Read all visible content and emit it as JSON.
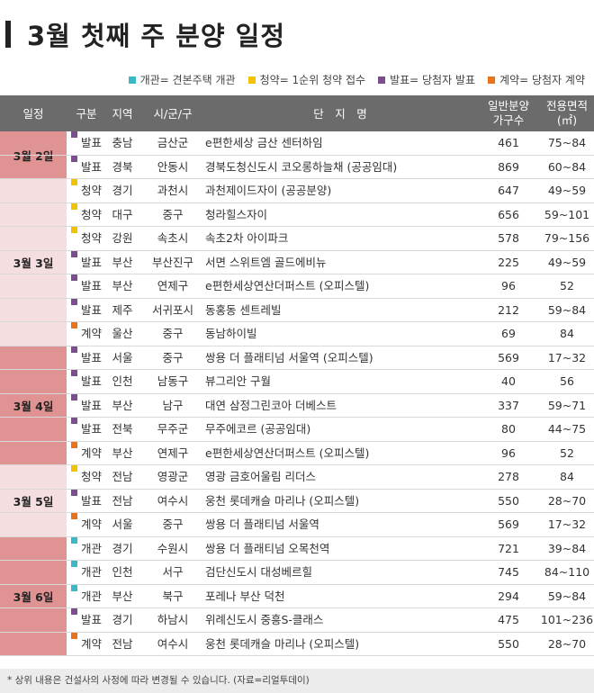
{
  "title": "3월 첫째 주 분양 일정",
  "legend": [
    {
      "label": "개관= 견본주택 개관",
      "color": "#3ab8c4"
    },
    {
      "label": "청약= 1순위 청약 접수",
      "color": "#f2c200"
    },
    {
      "label": "발표= 당첨자 발표",
      "color": "#7b4f8f"
    },
    {
      "label": "계약= 당첨자 계약",
      "color": "#e8731a"
    }
  ],
  "headers": {
    "date": "일정",
    "type": "구분",
    "region": "지역",
    "city": "시/군/구",
    "name": "단　지　명",
    "units_1": "일반분양",
    "units_2": "가구수",
    "area_1": "전용면적",
    "area_2": "(㎡)"
  },
  "groups": [
    {
      "date": "3월 2일",
      "bg": "#e09393",
      "rows": [
        {
          "type": "발표",
          "color": "#7b4f8f",
          "region": "충남",
          "city": "금산군",
          "name": "e편한세상 금산 센터하임",
          "units": "461",
          "area": "75~84"
        },
        {
          "type": "발표",
          "color": "#7b4f8f",
          "region": "경북",
          "city": "안동시",
          "name": "경북도청신도시 코오롱하늘채 (공공임대)",
          "units": "869",
          "area": "60~84"
        }
      ]
    },
    {
      "date": "3월 3일",
      "bg": "#f5dedf",
      "rows": [
        {
          "type": "청약",
          "color": "#f2c200",
          "region": "경기",
          "city": "과천시",
          "name": "과천제이드자이 (공공분양)",
          "units": "647",
          "area": "49~59"
        },
        {
          "type": "청약",
          "color": "#f2c200",
          "region": "대구",
          "city": "중구",
          "name": "청라힐스자이",
          "units": "656",
          "area": "59~101"
        },
        {
          "type": "청약",
          "color": "#f2c200",
          "region": "강원",
          "city": "속초시",
          "name": "속초2차 아이파크",
          "units": "578",
          "area": "79~156"
        },
        {
          "type": "발표",
          "color": "#7b4f8f",
          "region": "부산",
          "city": "부산진구",
          "name": "서면 스위트엠 골드에비뉴",
          "units": "225",
          "area": "49~59"
        },
        {
          "type": "발표",
          "color": "#7b4f8f",
          "region": "부산",
          "city": "연제구",
          "name": "e편한세상연산더퍼스트 (오피스텔)",
          "units": "96",
          "area": "52"
        },
        {
          "type": "발표",
          "color": "#7b4f8f",
          "region": "제주",
          "city": "서귀포시",
          "name": "동홍동 센트레빌",
          "units": "212",
          "area": "59~84"
        },
        {
          "type": "계약",
          "color": "#e8731a",
          "region": "울산",
          "city": "중구",
          "name": "동남하이빌",
          "units": "69",
          "area": "84"
        }
      ]
    },
    {
      "date": "3월 4일",
      "bg": "#e09393",
      "rows": [
        {
          "type": "발표",
          "color": "#7b4f8f",
          "region": "서울",
          "city": "중구",
          "name": "쌍용 더 플래티넘 서울역 (오피스텔)",
          "units": "569",
          "area": "17~32"
        },
        {
          "type": "발표",
          "color": "#7b4f8f",
          "region": "인천",
          "city": "남동구",
          "name": "뷰그리안 구월",
          "units": "40",
          "area": "56"
        },
        {
          "type": "발표",
          "color": "#7b4f8f",
          "region": "부산",
          "city": "남구",
          "name": "대연 삼정그린코아 더베스트",
          "units": "337",
          "area": "59~71"
        },
        {
          "type": "발표",
          "color": "#7b4f8f",
          "region": "전북",
          "city": "무주군",
          "name": "무주에코르 (공공임대)",
          "units": "80",
          "area": "44~75"
        },
        {
          "type": "계약",
          "color": "#e8731a",
          "region": "부산",
          "city": "연제구",
          "name": "e편한세상연산더퍼스트 (오피스텔)",
          "units": "96",
          "area": "52"
        }
      ]
    },
    {
      "date": "3월 5일",
      "bg": "#f5dedf",
      "rows": [
        {
          "type": "청약",
          "color": "#f2c200",
          "region": "전남",
          "city": "영광군",
          "name": "영광 금호어울림 리더스",
          "units": "278",
          "area": "84"
        },
        {
          "type": "발표",
          "color": "#7b4f8f",
          "region": "전남",
          "city": "여수시",
          "name": "웅천 롯데캐슬 마리나 (오피스텔)",
          "units": "550",
          "area": "28~70"
        },
        {
          "type": "계약",
          "color": "#e8731a",
          "region": "서울",
          "city": "중구",
          "name": "쌍용 더 플래티넘 서울역",
          "units": "569",
          "area": "17~32"
        }
      ]
    },
    {
      "date": "3월 6일",
      "bg": "#e09393",
      "rows": [
        {
          "type": "개관",
          "color": "#3ab8c4",
          "region": "경기",
          "city": "수원시",
          "name": "쌍용 더 플래티넘 오목천역",
          "units": "721",
          "area": "39~84"
        },
        {
          "type": "개관",
          "color": "#3ab8c4",
          "region": "인천",
          "city": "서구",
          "name": "검단신도시 대성베르힐",
          "units": "745",
          "area": "84~110"
        },
        {
          "type": "개관",
          "color": "#3ab8c4",
          "region": "부산",
          "city": "북구",
          "name": "포레나 부산 덕천",
          "units": "294",
          "area": "59~84"
        },
        {
          "type": "발표",
          "color": "#7b4f8f",
          "region": "경기",
          "city": "하남시",
          "name": "위례신도시 중흥S-클래스",
          "units": "475",
          "area": "101~236"
        },
        {
          "type": "계약",
          "color": "#e8731a",
          "region": "전남",
          "city": "여수시",
          "name": "웅천 롯데캐슬 마리나 (오피스텔)",
          "units": "550",
          "area": "28~70"
        }
      ]
    }
  ],
  "footnote": "* 상위 내용은 건설사의 사정에 따라 변경될 수 있습니다. (자료=리얼투데이)"
}
